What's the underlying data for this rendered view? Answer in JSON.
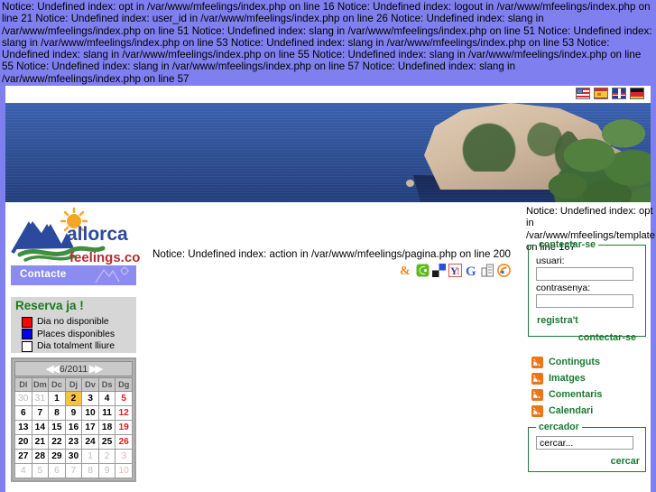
{
  "php_notices": {
    "top": "Notice: Undefined index: opt in /var/www/mfeelings/index.php on line 16 Notice: Undefined index: logout in /var/www/mfeelings/index.php on line 21 Notice: Undefined index: user_id in /var/www/mfeelings/index.php on line 26 Notice: Undefined index: slang in /var/www/mfeelings/index.php on line 51 Notice: Undefined index: slang in /var/www/mfeelings/index.php on line 51 Notice: Undefined index: slang in /var/www/mfeelings/index.php on line 53 Notice: Undefined index: slang in /var/www/mfeelings/index.php on line 53 Notice: Undefined index: slang in /var/www/mfeelings/index.php on line 55 Notice: Undefined index: slang in /var/www/mfeelings/index.php on line 55 Notice: Undefined index: slang in /var/www/mfeelings/index.php on line 57 Notice: Undefined index: slang in /var/www/mfeelings/index.php on line 57",
    "center": "Notice: Undefined index: action in /var/www/mfeelings/pagina.php on line 200",
    "right": "Notice: Undefined index: opt in /var/www/mfeelings/template.php on line 167"
  },
  "languages": [
    {
      "code": "us",
      "name": "english-flag-icon",
      "title": "English"
    },
    {
      "code": "es",
      "name": "spanish-flag-icon",
      "title": "Espanol"
    },
    {
      "code": "uk",
      "name": "british-flag-icon",
      "title": "English UK"
    },
    {
      "code": "de",
      "name": "german-flag-icon",
      "title": "Deutsch"
    }
  ],
  "logo": {
    "brand_main": "allorca",
    "brand_sub": "feelings.com",
    "accent_green": "#3f8f3f",
    "accent_blue": "#2b4a9e",
    "accent_sun": "#f5a623"
  },
  "nav": {
    "items": [
      {
        "label": "Contacte"
      }
    ],
    "bg": "#8c8cf0"
  },
  "reserva": {
    "title": "Reserva ja !",
    "legend": [
      {
        "label": "Dia no disponible",
        "color": "#ff0000"
      },
      {
        "label": "Places disponibles",
        "color": "#0000ee"
      },
      {
        "label": "Dia totalment lliure",
        "color": "#ffffff"
      }
    ]
  },
  "calendar": {
    "month_label": "6/2011",
    "prev": "◀◀",
    "next": "▶▶",
    "weekdays": [
      "Dl",
      "Dm",
      "Dc",
      "Dj",
      "Dv",
      "Ds",
      "Dg"
    ],
    "today": 2,
    "weeks": [
      [
        {
          "d": "30",
          "o": true
        },
        {
          "d": "31",
          "o": true
        },
        {
          "d": "1"
        },
        {
          "d": "2",
          "t": true
        },
        {
          "d": "3"
        },
        {
          "d": "4"
        },
        {
          "d": "5",
          "s": true
        }
      ],
      [
        {
          "d": "6"
        },
        {
          "d": "7"
        },
        {
          "d": "8"
        },
        {
          "d": "9"
        },
        {
          "d": "10"
        },
        {
          "d": "11"
        },
        {
          "d": "12",
          "s": true
        }
      ],
      [
        {
          "d": "13"
        },
        {
          "d": "14"
        },
        {
          "d": "15"
        },
        {
          "d": "16"
        },
        {
          "d": "17"
        },
        {
          "d": "18"
        },
        {
          "d": "19",
          "s": true
        }
      ],
      [
        {
          "d": "20"
        },
        {
          "d": "21"
        },
        {
          "d": "22"
        },
        {
          "d": "23"
        },
        {
          "d": "24"
        },
        {
          "d": "25"
        },
        {
          "d": "26",
          "s": true
        }
      ],
      [
        {
          "d": "27"
        },
        {
          "d": "28"
        },
        {
          "d": "29"
        },
        {
          "d": "30"
        },
        {
          "d": "1",
          "o": true
        },
        {
          "d": "2",
          "o": true
        },
        {
          "d": "3",
          "o": true,
          "s": true
        }
      ],
      [
        {
          "d": "4",
          "o": true
        },
        {
          "d": "5",
          "o": true
        },
        {
          "d": "6",
          "o": true
        },
        {
          "d": "7",
          "o": true
        },
        {
          "d": "8",
          "o": true
        },
        {
          "d": "9",
          "o": true
        },
        {
          "d": "10",
          "o": true,
          "s": true
        }
      ]
    ]
  },
  "social_bookmarks": [
    {
      "name": "misterwong-icon",
      "glyph": "&"
    },
    {
      "name": "yigg-icon",
      "glyph": "e"
    },
    {
      "name": "delicious-icon",
      "glyph": ""
    },
    {
      "name": "yahoo-icon",
      "glyph": "Y!"
    },
    {
      "name": "google-icon",
      "glyph": "G"
    },
    {
      "name": "digg-icon",
      "glyph": ""
    },
    {
      "name": "feed-icon",
      "glyph": ""
    }
  ],
  "login": {
    "legend": "contectar-se",
    "user_label": "usuari:",
    "user_value": "",
    "pass_label": "contrasenya:",
    "pass_value": "",
    "register_link": "registra't",
    "submit_link": "contectar-se"
  },
  "feeds": [
    {
      "label": "Continguts"
    },
    {
      "label": "Imatges"
    },
    {
      "label": "Comentaris"
    },
    {
      "label": "Calendari"
    }
  ],
  "search": {
    "legend": "cercador",
    "value": "cercar...",
    "submit_link": "cercar"
  },
  "colors": {
    "page_bg": "#7f7ff0",
    "content_bg": "#ffffff",
    "green": "#1a7a32",
    "nav_purple": "#8c8cf0",
    "panel_grey": "#d6d6d6"
  }
}
